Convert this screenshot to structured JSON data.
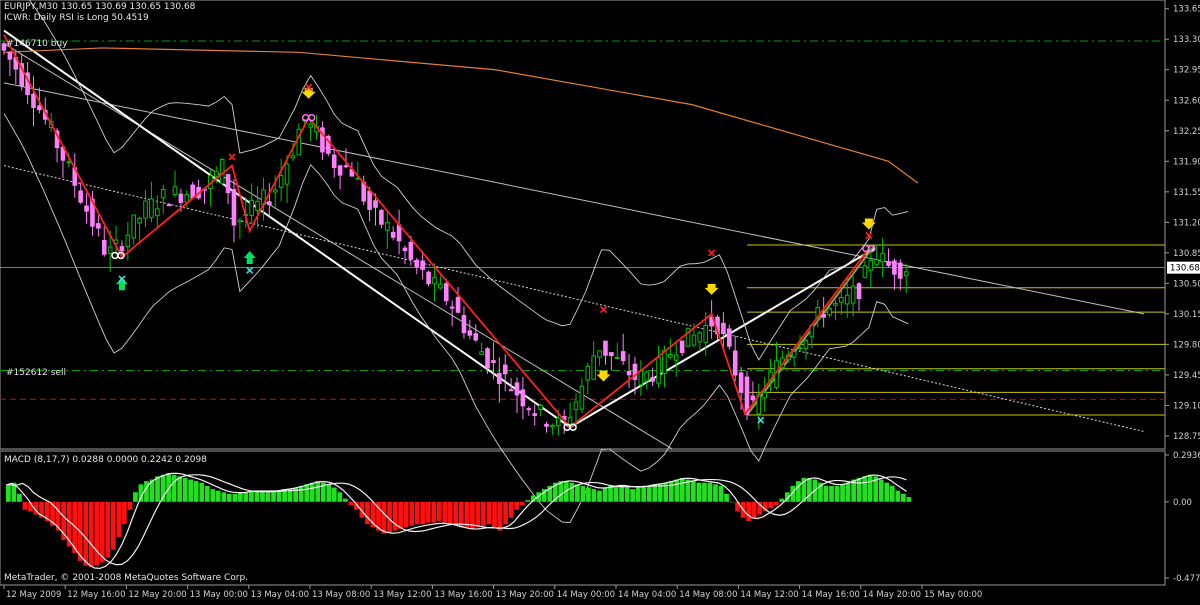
{
  "header": {
    "symbol_line": "EURJPY,M30  130.65 130.69 130.65 130.68",
    "indicator_line": "ICWR: Daily RSI is Long 50.4519"
  },
  "annotations": {
    "buy_order": "#146710 buy",
    "sell_order": "#152612 sell"
  },
  "footer": {
    "copyright": "MetaTrader, © 2001-2008 MetaQuotes Software Corp."
  },
  "colors": {
    "background": "#000000",
    "bull_candle": "#00c000",
    "bear_candle": "#ff80ff",
    "zigzag": "#ff2020",
    "channel": "#ffffff",
    "fib": "#c8c800",
    "ma_long": "#e08030",
    "bands": "#d0d0d0",
    "macd_pos": "#20e020",
    "macd_neg": "#ff1010",
    "arrow_down": "#ffd700",
    "arrow_up": "#00e060",
    "x_red": "#ff2020",
    "x_cyan": "#40e0e0"
  },
  "chart_data": [
    {
      "type": "candlestick",
      "symbol": "EURJPY",
      "timeframe": "M30",
      "ylim": [
        128.6,
        133.75
      ],
      "yticks": [
        "133.65",
        "133.30",
        "132.95",
        "132.60",
        "132.25",
        "131.90",
        "131.55",
        "131.20",
        "130.85",
        "130.50",
        "130.15",
        "129.80",
        "129.45",
        "129.10",
        "128.75"
      ],
      "current_price": "130.68",
      "xticks": [
        "12 May 2009",
        "12 May 16:00",
        "12 May 20:00",
        "13 May 00:00",
        "13 May 04:00",
        "13 May 08:00",
        "13 May 12:00",
        "13 May 16:00",
        "13 May 20:00",
        "14 May 00:00",
        "14 May 04:00",
        "14 May 08:00",
        "14 May 12:00",
        "14 May 16:00",
        "14 May 20:00",
        "15 May 00:00"
      ],
      "price_path": [
        [
          0,
          133.25
        ],
        [
          10,
          132.95
        ],
        [
          20,
          132.55
        ],
        [
          30,
          132.1
        ],
        [
          40,
          131.6
        ],
        [
          50,
          131.1
        ],
        [
          55,
          130.85
        ],
        [
          58,
          130.85
        ],
        [
          65,
          131.05
        ],
        [
          75,
          131.35
        ],
        [
          85,
          131.5
        ],
        [
          95,
          131.55
        ],
        [
          105,
          131.6
        ],
        [
          115,
          131.85
        ],
        [
          120,
          131.2
        ],
        [
          130,
          131.35
        ],
        [
          140,
          131.55
        ],
        [
          150,
          132.05
        ],
        [
          155,
          132.4
        ],
        [
          162,
          132.2
        ],
        [
          170,
          131.9
        ],
        [
          180,
          131.8
        ],
        [
          190,
          131.3
        ],
        [
          200,
          131.1
        ],
        [
          210,
          130.75
        ],
        [
          220,
          130.5
        ],
        [
          230,
          130.3
        ],
        [
          240,
          129.9
        ],
        [
          250,
          129.6
        ],
        [
          262,
          129.3
        ],
        [
          275,
          129.0
        ],
        [
          287,
          128.85
        ],
        [
          295,
          129.2
        ],
        [
          305,
          129.8
        ],
        [
          315,
          129.6
        ],
        [
          325,
          129.4
        ],
        [
          335,
          129.5
        ],
        [
          345,
          129.8
        ],
        [
          355,
          129.9
        ],
        [
          365,
          130.1
        ],
        [
          375,
          129.5
        ],
        [
          383,
          129.0
        ],
        [
          390,
          129.3
        ],
        [
          400,
          129.7
        ],
        [
          410,
          129.9
        ],
        [
          420,
          130.2
        ],
        [
          430,
          130.25
        ],
        [
          440,
          130.5
        ],
        [
          445,
          130.9
        ],
        [
          452,
          130.7
        ],
        [
          460,
          130.68
        ]
      ],
      "zigzag": [
        [
          0,
          133.35
        ],
        [
          60,
          130.8
        ],
        [
          116,
          131.85
        ],
        [
          125,
          131.1
        ],
        [
          155,
          132.4
        ],
        [
          288,
          128.85
        ],
        [
          360,
          130.15
        ],
        [
          377,
          129.0
        ],
        [
          440,
          130.9
        ]
      ],
      "fib_levels": [
        "130.94",
        "130.45",
        "130.17",
        "129.80",
        "129.52",
        "129.25",
        "128.99"
      ],
      "long_ma": [
        [
          0,
          133.15
        ],
        [
          50,
          133.2
        ],
        [
          150,
          133.15
        ],
        [
          250,
          132.95
        ],
        [
          350,
          132.55
        ],
        [
          450,
          131.9
        ],
        [
          465,
          131.65
        ]
      ],
      "markers": {
        "arrow_down": [
          155,
          305,
          360,
          440
        ],
        "arrow_up": [
          60,
          125
        ],
        "x_red": [
          [
            116,
            131.95
          ],
          [
            155,
            132.75
          ],
          [
            305,
            130.2
          ],
          [
            360,
            130.85
          ],
          [
            440,
            131.05
          ]
        ],
        "x_cyan": [
          [
            60,
            130.55
          ],
          [
            125,
            130.65
          ],
          [
            385,
            128.93
          ]
        ]
      }
    },
    {
      "type": "bar",
      "title": "MACD (8,17,7) 0.0288 0.0000 0.2242 0.2098",
      "ylim": [
        -0.4775,
        0.2936
      ],
      "yticks": [
        "0.2936",
        "0.00",
        "-0.4775"
      ],
      "values": [
        0.1,
        0.12,
        0.05,
        -0.05,
        -0.06,
        -0.08,
        -0.1,
        -0.12,
        -0.15,
        -0.18,
        -0.24,
        -0.28,
        -0.32,
        -0.37,
        -0.4,
        -0.41,
        -0.4,
        -0.38,
        -0.35,
        -0.3,
        -0.22,
        -0.14,
        -0.05,
        0.06,
        0.11,
        0.13,
        0.14,
        0.16,
        0.17,
        0.18,
        0.17,
        0.16,
        0.15,
        0.14,
        0.13,
        0.12,
        0.1,
        0.08,
        0.07,
        0.06,
        0.05,
        0.05,
        0.06,
        0.06,
        0.07,
        0.07,
        0.06,
        0.06,
        0.07,
        0.07,
        0.08,
        0.08,
        0.09,
        0.1,
        0.11,
        0.12,
        0.13,
        0.12,
        0.11,
        0.09,
        0.06,
        0.02,
        -0.02,
        -0.05,
        -0.1,
        -0.14,
        -0.16,
        -0.18,
        -0.2,
        -0.19,
        -0.18,
        -0.17,
        -0.16,
        -0.15,
        -0.14,
        -0.14,
        -0.13,
        -0.13,
        -0.12,
        -0.13,
        -0.14,
        -0.15,
        -0.16,
        -0.16,
        -0.17,
        -0.16,
        -0.15,
        -0.14,
        -0.16,
        -0.18,
        -0.14,
        -0.1,
        -0.05,
        -0.02,
        0.01,
        0.04,
        0.06,
        0.08,
        0.1,
        0.12,
        0.13,
        0.13,
        0.12,
        0.11,
        0.1,
        0.09,
        0.08,
        0.07,
        0.09,
        0.1,
        0.1,
        0.1,
        0.09,
        0.08,
        0.09,
        0.1,
        0.1,
        0.11,
        0.11,
        0.12,
        0.13,
        0.14,
        0.15,
        0.14,
        0.13,
        0.12,
        0.12,
        0.12,
        0.11,
        0.1,
        0.05,
        0.0,
        -0.06,
        -0.1,
        -0.12,
        -0.1,
        -0.08,
        -0.06,
        -0.04,
        -0.02,
        0.02,
        0.06,
        0.1,
        0.13,
        0.15,
        0.15,
        0.14,
        0.12,
        0.1,
        0.1,
        0.1,
        0.11,
        0.12,
        0.14,
        0.15,
        0.16,
        0.17,
        0.16,
        0.14,
        0.12,
        0.1,
        0.07,
        0.05,
        0.03
      ]
    }
  ]
}
